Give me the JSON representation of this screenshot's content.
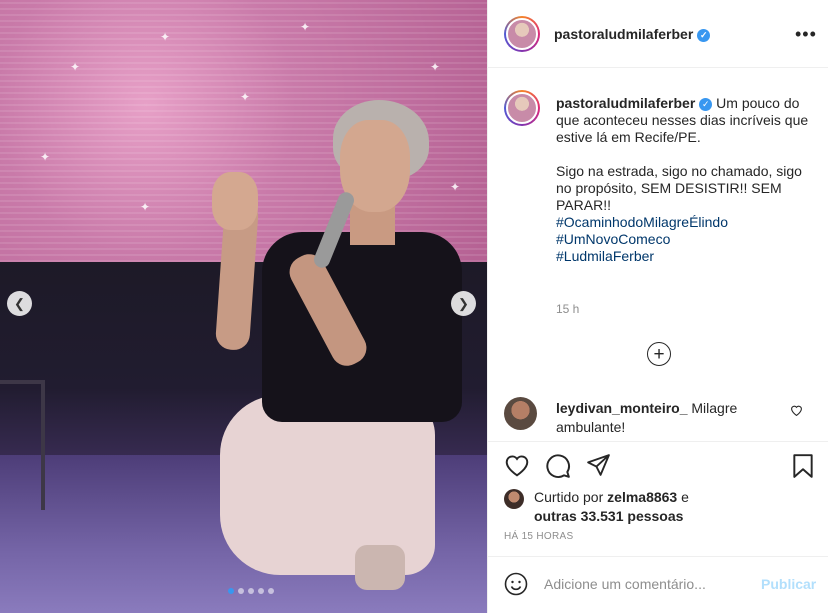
{
  "post": {
    "username": "pastoraludmilaferber",
    "more_icon": "more-icon"
  },
  "caption": {
    "username": "pastoraludmilaferber",
    "text": "Um pouco do que aconteceu nesses dias incríveis que estive lá em Recife/PE.\n\nSigo na estrada, sigo no chamado, sigo no propósito, SEM DESISTIR!! SEM PARAR!!\n",
    "hashtags": [
      "#OcaminhodoMilagreÉlindo",
      "#UmNovoComeco",
      "#LudmilaFerber"
    ],
    "time": "15 h"
  },
  "comment": {
    "username": "leydivan_monteiro_",
    "text": "Milagre ambulante!"
  },
  "likes": {
    "prefix": "Curtido por",
    "user": "zelma8863",
    "connector": "e",
    "others": "outras 33.531 pessoas"
  },
  "timestamp": "HÁ 15 HORAS",
  "add_comment": {
    "placeholder": "Adicione um comentário...",
    "post_label": "Publicar"
  },
  "carousel": {
    "total": 5,
    "active": 0
  },
  "colors": {
    "accent": "#3897f0",
    "hashtag": "#00376b",
    "post_button_disabled": "#b2dffc"
  }
}
